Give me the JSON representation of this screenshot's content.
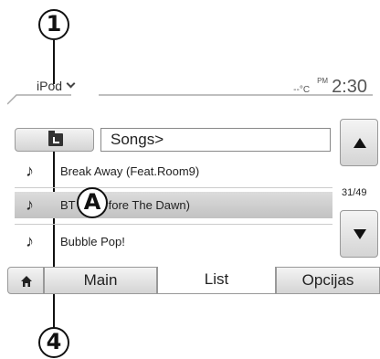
{
  "callouts": {
    "top": "1",
    "center": "A",
    "bottom": "4"
  },
  "header": {
    "source_label": "iPod",
    "temperature": "--°C",
    "ampm": "PM",
    "time": "2:30"
  },
  "browser": {
    "path": "Songs>",
    "items": [
      {
        "title": "Break Away (Feat.Room9)",
        "selected": false
      },
      {
        "title": "BT",
        "title_tail": "fore The Dawn)",
        "selected": true
      },
      {
        "title": "Bubble Pop!",
        "selected": false
      }
    ],
    "counter": "31/49"
  },
  "tabs": {
    "home_icon": "home-icon",
    "main": "Main",
    "list": "List",
    "options": "Opcijas"
  },
  "icons": {
    "folder": "folder-up-icon",
    "note": "music-note-icon",
    "scroll_up": "triangle-up-icon",
    "scroll_down": "triangle-down-icon"
  },
  "colors": {
    "selected_row": "#c8c8c8",
    "text": "#222222"
  }
}
